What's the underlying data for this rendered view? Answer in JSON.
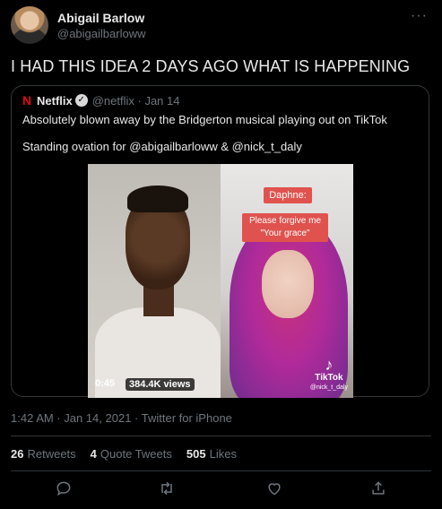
{
  "author": {
    "name": "Abigail Barlow",
    "handle": "@abigailbarloww"
  },
  "tweet": {
    "text": "I HAD THIS IDEA 2 DAYS AGO WHAT IS HAPPENING"
  },
  "quote": {
    "logo": "N",
    "name": "Netflix",
    "verified_mark": "✓",
    "meta": "@netflix · Jan 14",
    "text1": "Absolutely blown away by the Bridgerton musical playing out on TikTok",
    "text2": "Standing ovation for @abigailbarloww & @nick_t_daly",
    "video": {
      "caption1": "Daphne:",
      "caption2_line1": "Please forgive me",
      "caption2_line2": "\"Your grace\"",
      "duration": "0:45",
      "views": "384.4K views",
      "tiktok_label": "TikTok",
      "tiktok_handle": "@nick_t_daly"
    }
  },
  "timestamp": "1:42 AM · Jan 14, 2021 · Twitter for iPhone",
  "stats": {
    "retweets_count": "26",
    "retweets_label": "Retweets",
    "quotes_count": "4",
    "quotes_label": "Quote Tweets",
    "likes_count": "505",
    "likes_label": "Likes"
  },
  "icons": [
    "more-icon",
    "verified-icon",
    "reply-icon",
    "retweet-icon",
    "like-icon",
    "share-icon",
    "tiktok-icon"
  ]
}
